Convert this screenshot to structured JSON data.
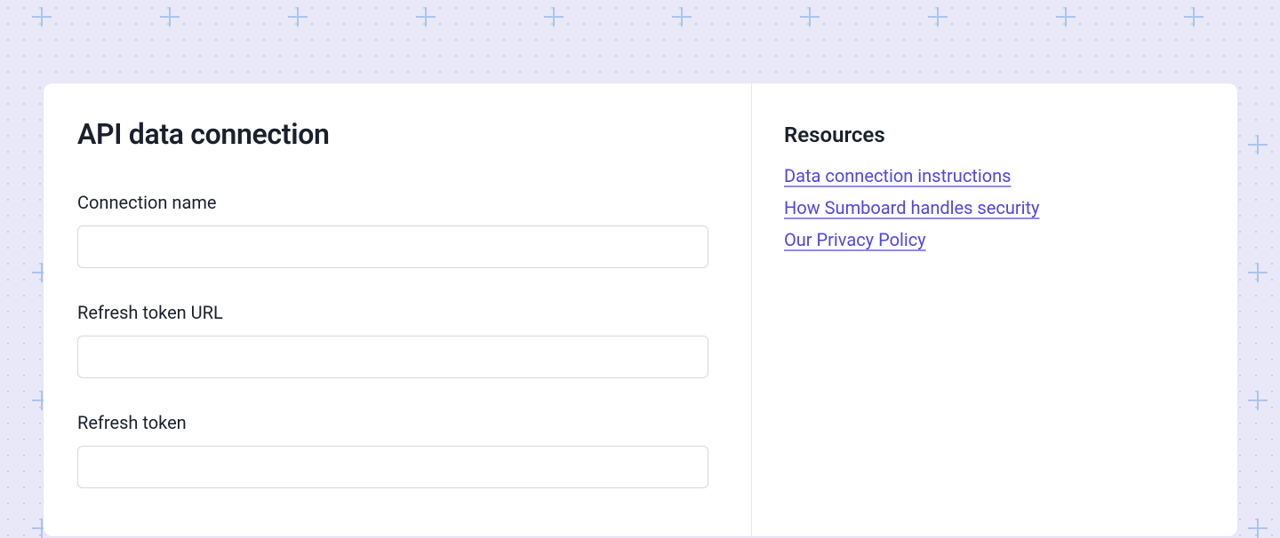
{
  "main": {
    "title": "API data connection",
    "fields": {
      "connection_name": {
        "label": "Connection name",
        "value": ""
      },
      "refresh_token_url": {
        "label": "Refresh token URL",
        "value": ""
      },
      "refresh_token": {
        "label": "Refresh token",
        "value": ""
      }
    }
  },
  "sidebar": {
    "title": "Resources",
    "links": [
      "Data connection instructions",
      "How Sumboard handles security",
      "Our Privacy Policy"
    ]
  }
}
